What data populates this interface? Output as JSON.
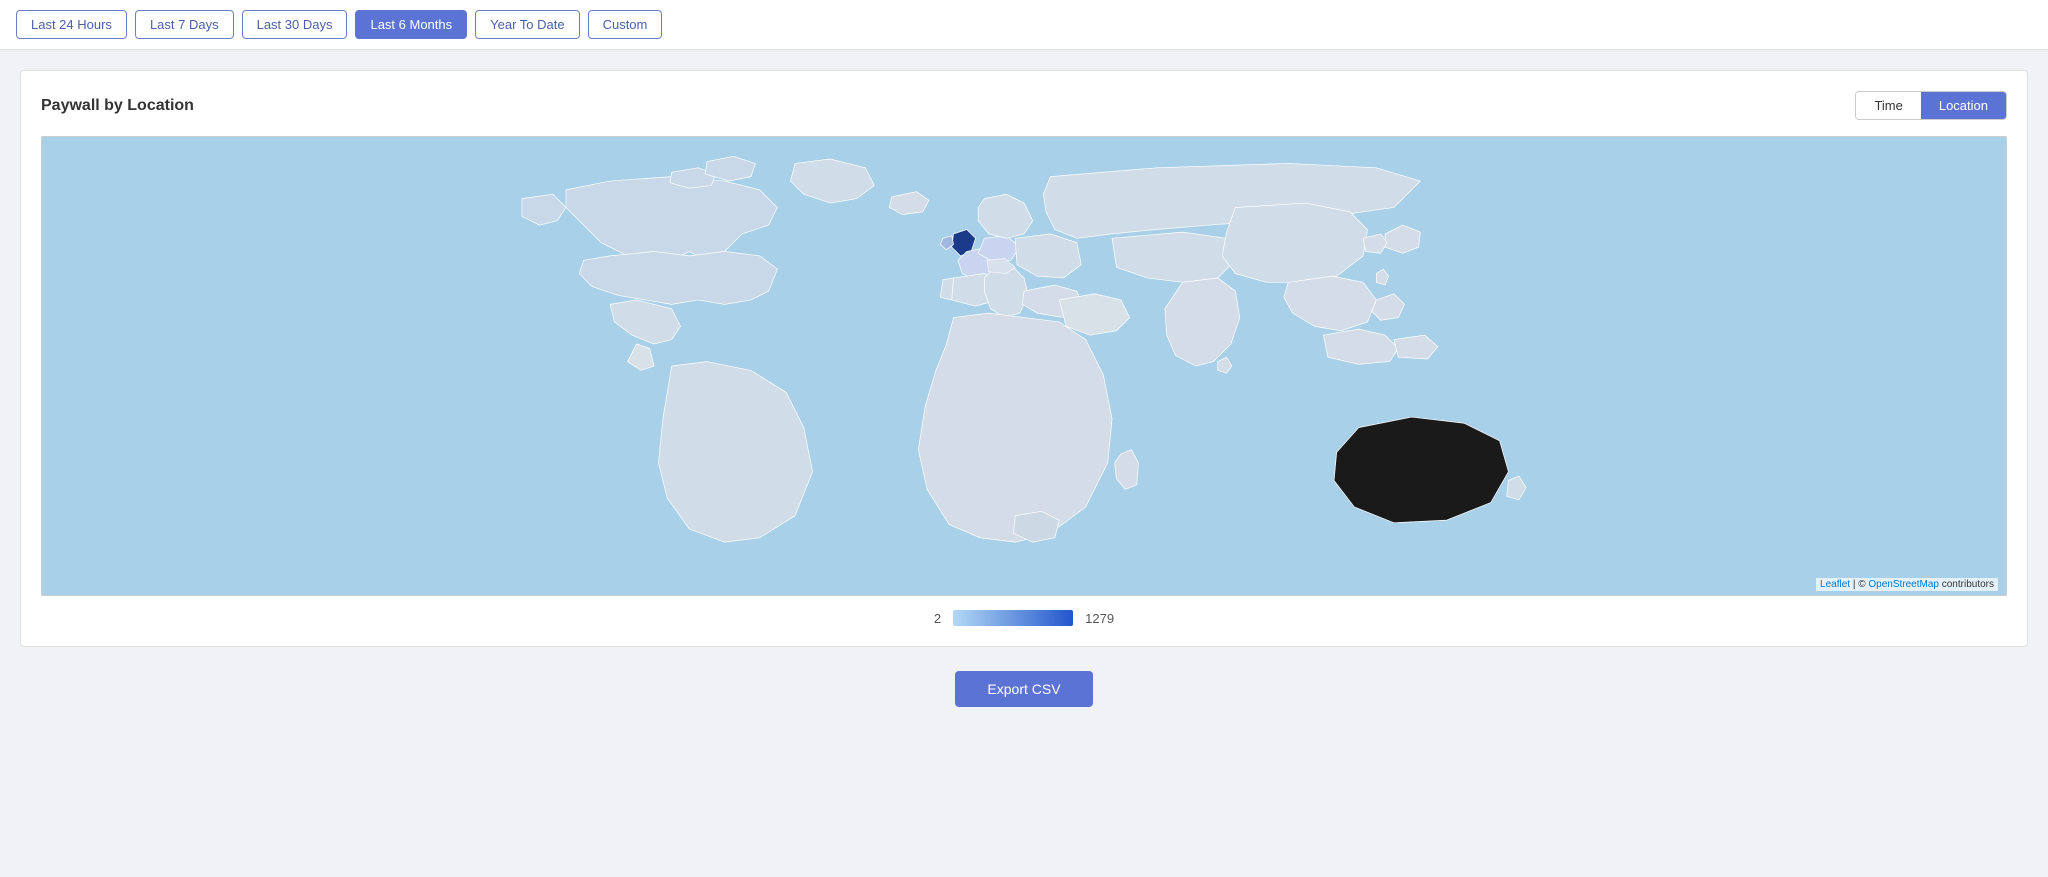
{
  "toolbar": {
    "buttons": [
      {
        "id": "last-24-hours",
        "label": "Last 24 Hours",
        "active": false
      },
      {
        "id": "last-7-days",
        "label": "Last 7 Days",
        "active": false
      },
      {
        "id": "last-30-days",
        "label": "Last 30 Days",
        "active": false
      },
      {
        "id": "last-6-months",
        "label": "Last 6 Months",
        "active": true
      },
      {
        "id": "year-to-date",
        "label": "Year To Date",
        "active": false
      },
      {
        "id": "custom",
        "label": "Custom",
        "active": false
      }
    ]
  },
  "card": {
    "title": "Paywall by Location",
    "view_toggle": {
      "time_label": "Time",
      "location_label": "Location",
      "active": "location"
    }
  },
  "legend": {
    "min_value": "2",
    "max_value": "1279"
  },
  "export": {
    "button_label": "Export CSV"
  },
  "attribution": {
    "leaflet": "Leaflet",
    "osm": "OpenStreetMap",
    "contributors": " contributors"
  }
}
